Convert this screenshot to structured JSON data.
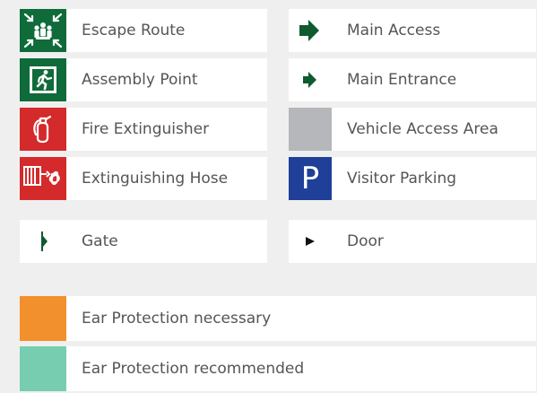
{
  "legend": {
    "left": {
      "escape_route": "Escape Route",
      "assembly_point": "Assembly Point",
      "fire_extinguisher": "Fire Extinguisher",
      "extinguishing_hose": "Extinguishing Hose",
      "gate": "Gate"
    },
    "right": {
      "main_access": "Main Access",
      "main_entrance": "Main Entrance",
      "vehicle_access_area": "Vehicle Access Area",
      "visitor_parking": "Visitor Parking",
      "visitor_parking_symbol": "P",
      "door": "Door"
    },
    "ear_protection": {
      "necessary": "Ear Protection necessary",
      "recommended": "Ear Protection recommended"
    }
  },
  "icons": {
    "escape_route": "escape-route-icon",
    "assembly_point": "assembly-point-icon",
    "fire_extinguisher": "fire-extinguisher-icon",
    "extinguishing_hose": "extinguishing-hose-icon",
    "gate": "gate-icon",
    "main_access": "main-access-arrow-icon",
    "main_entrance": "main-entrance-arrow-icon",
    "vehicle_access_area": "vehicle-access-swatch",
    "visitor_parking": "parking-icon",
    "door": "door-arrow-icon"
  },
  "colors": {
    "safety_green": "#0f6b3a",
    "fire_red": "#d42a2b",
    "parking_blue": "#1f3f98",
    "vehicle_gray": "#b5b7ba",
    "arrow_green": "#0d5b2f",
    "ear_necessary_orange": "#f2902d",
    "ear_recommended_teal": "#76cdb0",
    "label_text": "#555555",
    "background": "#efefef"
  }
}
